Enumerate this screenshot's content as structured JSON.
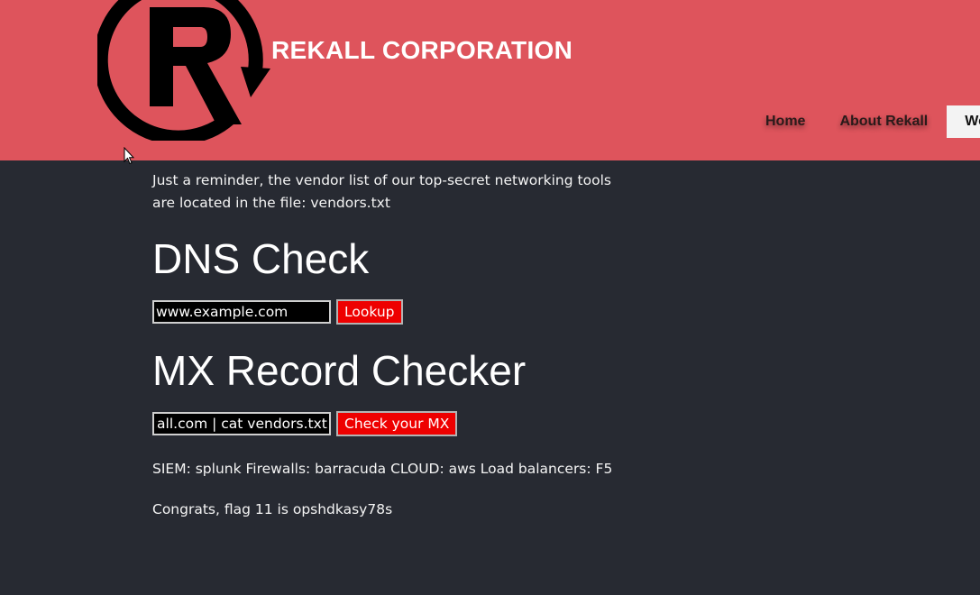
{
  "header": {
    "brand": "REKALL CORPORATION",
    "logo_icon": "rekall-r-logo-icon",
    "nav": [
      {
        "label": "Home"
      },
      {
        "label": "About Rekall"
      },
      {
        "label": "We"
      }
    ]
  },
  "main": {
    "reminder": "Just a reminder, the vendor list of our top-secret networking tools are located in the file: vendors.txt",
    "dns": {
      "title": "DNS Check",
      "input_value": "www.example.com",
      "button_label": "Lookup"
    },
    "mx": {
      "title": "MX Record Checker",
      "input_value": "ecall.com | cat vendors.txt",
      "button_label": "Check your MX"
    },
    "results": [
      "SIEM: splunk Firewalls: barracuda CLOUD: aws Load balancers: F5",
      "Congrats, flag 11 is opshdkasy78s"
    ]
  },
  "colors": {
    "header_bg": "#de545c",
    "page_bg": "#272a32",
    "button_bg": "#ee0000",
    "input_bg": "#000000"
  }
}
